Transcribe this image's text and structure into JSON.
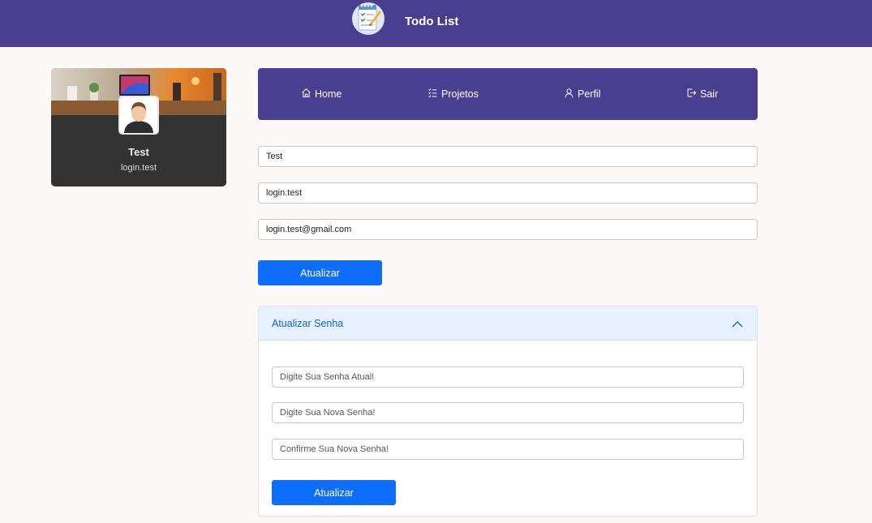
{
  "header": {
    "app_title": "Todo List",
    "logo_icon": "notepad-icon",
    "background": "#493e8f"
  },
  "profile": {
    "name": "Test",
    "login": "login.test",
    "avatar_icon": "user-avatar-icon"
  },
  "nav": {
    "items": [
      {
        "label": "Home",
        "icon": "home-icon"
      },
      {
        "label": "Projetos",
        "icon": "list-icon"
      },
      {
        "label": "Perfil",
        "icon": "person-icon"
      },
      {
        "label": "Sair",
        "icon": "logout-icon"
      }
    ]
  },
  "form": {
    "name_value": "Test",
    "login_value": "login.test",
    "email_value": "login.test@gmail.com",
    "submit_label": "Atualizar"
  },
  "password": {
    "title": "Atualizar Senha",
    "expanded": true,
    "current_placeholder": "Digite Sua Senha Atual!",
    "new_placeholder": "Digite Sua Nova Senha!",
    "confirm_placeholder": "Confirme Sua Nova Senha!",
    "submit_label": "Atualizar"
  },
  "colors": {
    "primary": "#0d6efd",
    "accent": "#493e8f",
    "card": "#333333"
  }
}
